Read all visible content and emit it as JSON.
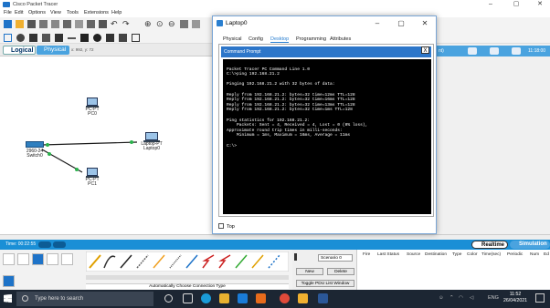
{
  "app": {
    "title": "Cisco Packet Tracer"
  },
  "menu": [
    "File",
    "Edit",
    "Options",
    "View",
    "Tools",
    "Extensions",
    "Help"
  ],
  "workspace": {
    "logical_label": "Logical",
    "physical_label": "Physical",
    "coords": "x: 992, y: 72",
    "devices": [
      {
        "model": "PC-PT",
        "name": "PC0"
      },
      {
        "model": "2960-24",
        "name": "Switch0"
      },
      {
        "model": "Laptop-PT",
        "name": "Laptop0"
      },
      {
        "model": "PC-PT",
        "name": "PC1"
      }
    ],
    "clock_right": "11:18:00",
    "cut_label": "nt)"
  },
  "timebar": {
    "time": "Time: 00:22:55",
    "realtime": "Realtime",
    "simulation": "Simulation"
  },
  "bottom": {
    "auto_label": "Automatically Choose Connection Type",
    "scenario": "Scenario 0",
    "new_btn": "New",
    "delete_btn": "Delete",
    "toggle_btn": "Toggle PDU List Window",
    "pdu_cols": [
      "Fire",
      "Last Status",
      "Source",
      "Destination",
      "Type",
      "Color",
      "Time(sec)",
      "Periodic",
      "Num",
      "Ed"
    ]
  },
  "dialog": {
    "title": "Laptop0",
    "tabs": [
      "Physical",
      "Config",
      "Desktop",
      "Programming",
      "Attributes"
    ],
    "active_tab": "Desktop",
    "cmd_title": "Command Prompt",
    "close": "X",
    "terminal_lines": [
      "",
      "Packet Tracer PC Command Line 1.0",
      "C:\\>ping 192.168.21.2",
      "",
      "Pinging 192.168.21.2 with 32 bytes of data:",
      "",
      "Reply from 192.168.21.2: bytes=32 time=12ms TTL=128",
      "Reply from 192.168.21.2: bytes=32 time=16ms TTL=128",
      "Reply from 192.168.21.2: bytes=32 time=13ms TTL=128",
      "Reply from 192.168.21.2: bytes=32 time=1ms TTL=128",
      "",
      "Ping statistics for 192.168.21.2:",
      "    Packets: Sent = 4, Received = 4, Lost = 0 (0% loss),",
      "Approximate round trip times in milli-seconds:",
      "    Minimum = 1ms, Maximum = 16ms, Average = 11ms",
      "",
      "C:\\>"
    ],
    "top_checkbox": "Top"
  },
  "taskbar": {
    "search_placeholder": "Type here to search",
    "lang": "ENG",
    "time": "11:52",
    "date": "26/04/2021"
  }
}
